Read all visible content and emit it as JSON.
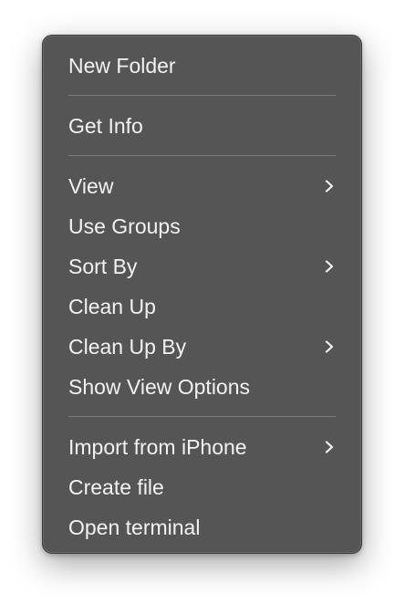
{
  "context_menu": {
    "groups": [
      {
        "items": [
          {
            "label": "New Folder",
            "submenu": false
          }
        ]
      },
      {
        "items": [
          {
            "label": "Get Info",
            "submenu": false
          }
        ]
      },
      {
        "items": [
          {
            "label": "View",
            "submenu": true
          },
          {
            "label": "Use Groups",
            "submenu": false
          },
          {
            "label": "Sort By",
            "submenu": true
          },
          {
            "label": "Clean Up",
            "submenu": false
          },
          {
            "label": "Clean Up By",
            "submenu": true
          },
          {
            "label": "Show View Options",
            "submenu": false
          }
        ]
      },
      {
        "items": [
          {
            "label": "Import from iPhone",
            "submenu": true
          },
          {
            "label": "Create file",
            "submenu": false
          },
          {
            "label": "Open terminal",
            "submenu": false
          }
        ]
      }
    ],
    "chevron_icon": "chevron-right-icon",
    "colors": {
      "menu_background": "#555555",
      "text": "#f2f2f2",
      "separator": "#7a7a7a"
    }
  }
}
